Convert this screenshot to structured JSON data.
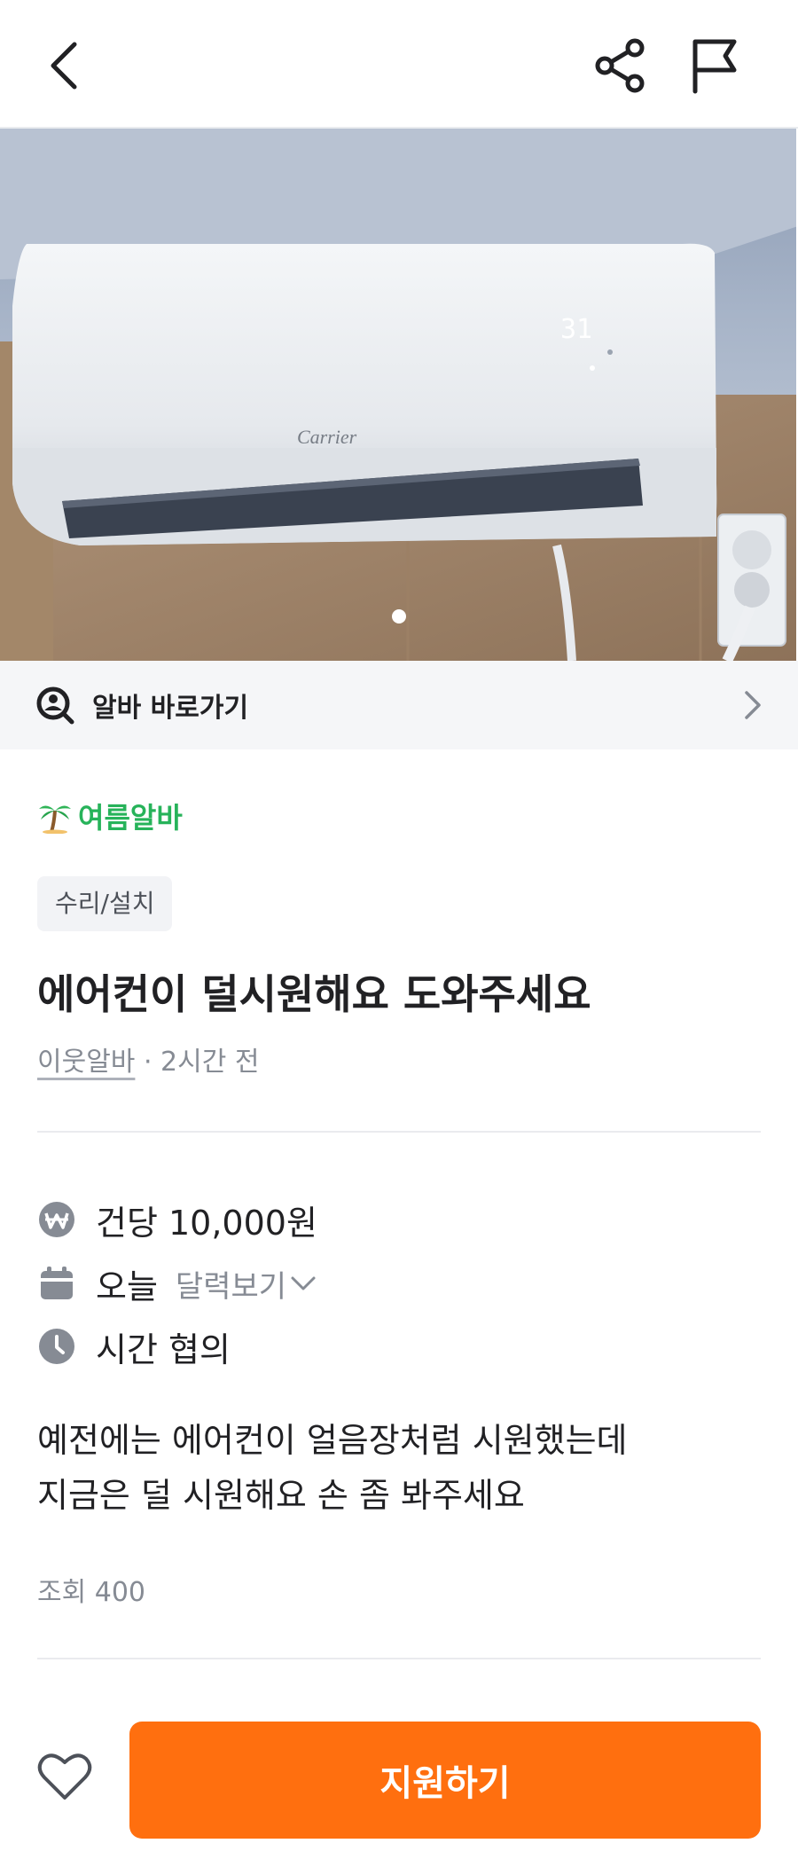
{
  "header": {
    "back_icon": "chevron-left-icon",
    "share_icon": "share-icon",
    "report_icon": "flag-icon"
  },
  "hero": {
    "photo_brand": "Carrier",
    "display_reading": "31",
    "page_indicator": {
      "current": 1,
      "total": 1
    }
  },
  "shortcut": {
    "label": "알바 바로가기",
    "icon": "search-person-icon",
    "arrow_icon": "chevron-right-icon"
  },
  "post": {
    "season_badge": "여름알바",
    "season_icon": "palm-tree-icon",
    "category": "수리/설치",
    "title": "에어컨이 덜시원해요 도와주세요",
    "author": "이웃알바",
    "separator": " · ",
    "posted": "2시간 전",
    "details": {
      "pay": "건당 10,000원",
      "date": "오늘",
      "calendar_link": "달력보기",
      "time": "시간 협의"
    },
    "description": [
      "예전에는 에어컨이 얼음장처럼 시원했는데",
      "지금은 덜 시원해요 손 좀 봐주세요"
    ],
    "views": "조회 400"
  },
  "footer": {
    "like_icon": "heart-icon",
    "apply_label": "지원하기"
  },
  "colors": {
    "accent": "#ff6f0f",
    "season_green": "#27b35a",
    "text_primary": "#212124",
    "text_secondary": "#868b94"
  }
}
